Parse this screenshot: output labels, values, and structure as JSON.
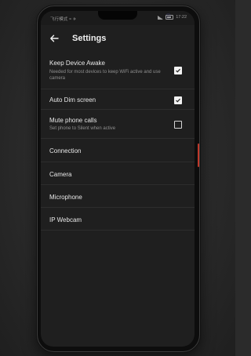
{
  "statusbar": {
    "left_text": "飞行模式 ≈ ✈",
    "time": "17:22"
  },
  "toolbar": {
    "title": "Settings",
    "back_icon": "arrow-left-icon"
  },
  "settings": [
    {
      "label": "Keep Device Awake",
      "subtitle": "Needed for most devices to keep WiFi active and use camera",
      "checked": true
    },
    {
      "label": "Auto Dim screen",
      "subtitle": "",
      "checked": true
    },
    {
      "label": "Mute phone calls",
      "subtitle": "Set phone to Silent when active",
      "checked": false
    }
  ],
  "menu": [
    {
      "label": "Connection"
    },
    {
      "label": "Camera"
    },
    {
      "label": "Microphone"
    },
    {
      "label": "IP Webcam"
    }
  ],
  "colors": {
    "background": "#1f1f1f",
    "text": "#e8e8e8",
    "subtext": "#8f8f8f",
    "divider": "#2d2d2d"
  }
}
